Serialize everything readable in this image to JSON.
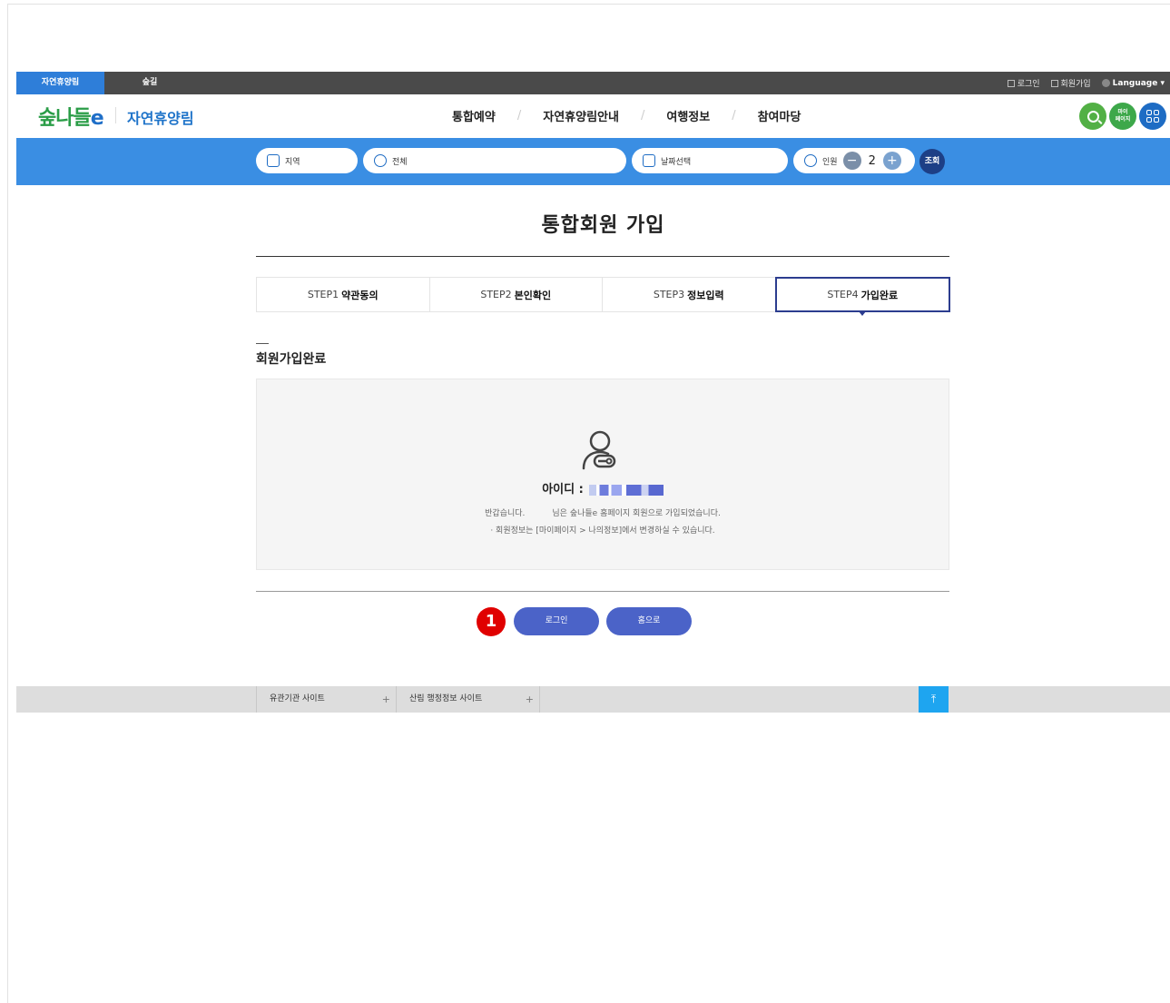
{
  "topbar": {
    "tab_active": "자연휴양림",
    "tab_second": "숲길",
    "login": "로그인",
    "signup": "회원가입",
    "language": "Language ▾"
  },
  "header": {
    "logo_text": "숲나들",
    "logo_e": "e",
    "brand": "자연휴양림",
    "nav": [
      "통합예약",
      "자연휴양림안내",
      "여행정보",
      "참여마당"
    ],
    "mypage_label": "마이\n페이지"
  },
  "search": {
    "region": "지역",
    "all": "전체",
    "date": "날짜선택",
    "people_label": "인원",
    "people_count": "2",
    "minus": "−",
    "plus": "+",
    "submit": "조회"
  },
  "main": {
    "page_title": "통합회원 가입",
    "steps": [
      {
        "prefix": "STEP1",
        "label": "약관동의"
      },
      {
        "prefix": "STEP2",
        "label": "본인확인"
      },
      {
        "prefix": "STEP3",
        "label": "정보입력"
      },
      {
        "prefix": "STEP4",
        "label": "가입완료"
      }
    ],
    "active_step": 4,
    "section_title": "회원가입완료",
    "id_label": "아이디 :",
    "message_1a": "반갑습니다.",
    "message_1b": "님은 숲나들e 홈페이지 회원으로 가입되었습니다.",
    "message_2": "· 회원정보는 [마이페이지 > 나의정보]에서 변경하실 수 있습니다.",
    "login_button": "로그인",
    "home_button": "홈으로",
    "marker": "1"
  },
  "footer": {
    "related_sites": "유관기관 사이트",
    "forest_sites": "산림 행정정보 사이트",
    "plus": "+",
    "top_arrow": "⤒"
  },
  "colors": {
    "accent_blue": "#3a8ee3",
    "button": "#4b63c8",
    "step_active": "#2c3d8f",
    "marker_red": "#e00000"
  }
}
